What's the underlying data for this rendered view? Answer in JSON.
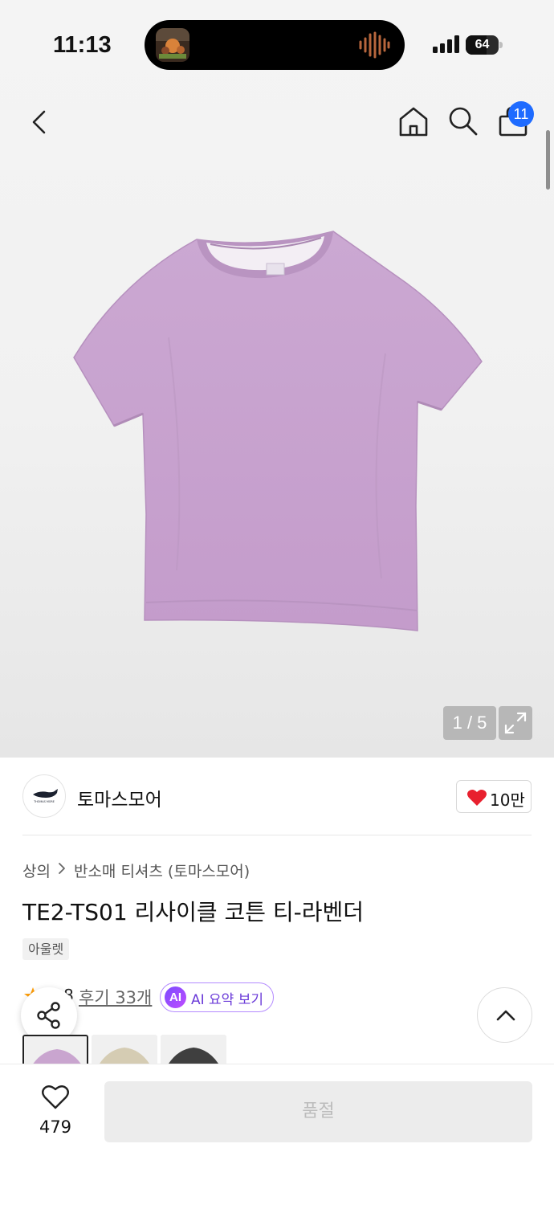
{
  "status_bar": {
    "time": "11:13",
    "battery": "64",
    "battery_level": 0.64
  },
  "header": {
    "cart_badge": "11"
  },
  "gallery": {
    "counter": "1 / 5"
  },
  "store": {
    "name": "토마스모어",
    "logo_text": "THOMAS MORE",
    "likes": "10만"
  },
  "breadcrumb": {
    "level1": "상의",
    "separator_icon": "chevron-right-icon",
    "level2": "반소매 티셔츠 (토마스모어)"
  },
  "product": {
    "title": "TE2-TS01 리사이클 코튼 티-라벤더",
    "tag": "아울렛",
    "rating": "4.8",
    "reviews": "후기 33개",
    "ai_badge": "AI",
    "ai_summary": "AI 요약 보기"
  },
  "swatches": [
    {
      "name": "lavender",
      "color": "#c9a5cf"
    },
    {
      "name": "beige",
      "color": "#d5ccb3"
    },
    {
      "name": "charcoal",
      "color": "#3f3f3f"
    }
  ],
  "bottom": {
    "wishlist_count": "479",
    "purchase_label": "품절"
  },
  "colors": {
    "accent_blue": "#1e6bff",
    "heart_red": "#e8202e",
    "ai_purple": "#7a4bff"
  }
}
